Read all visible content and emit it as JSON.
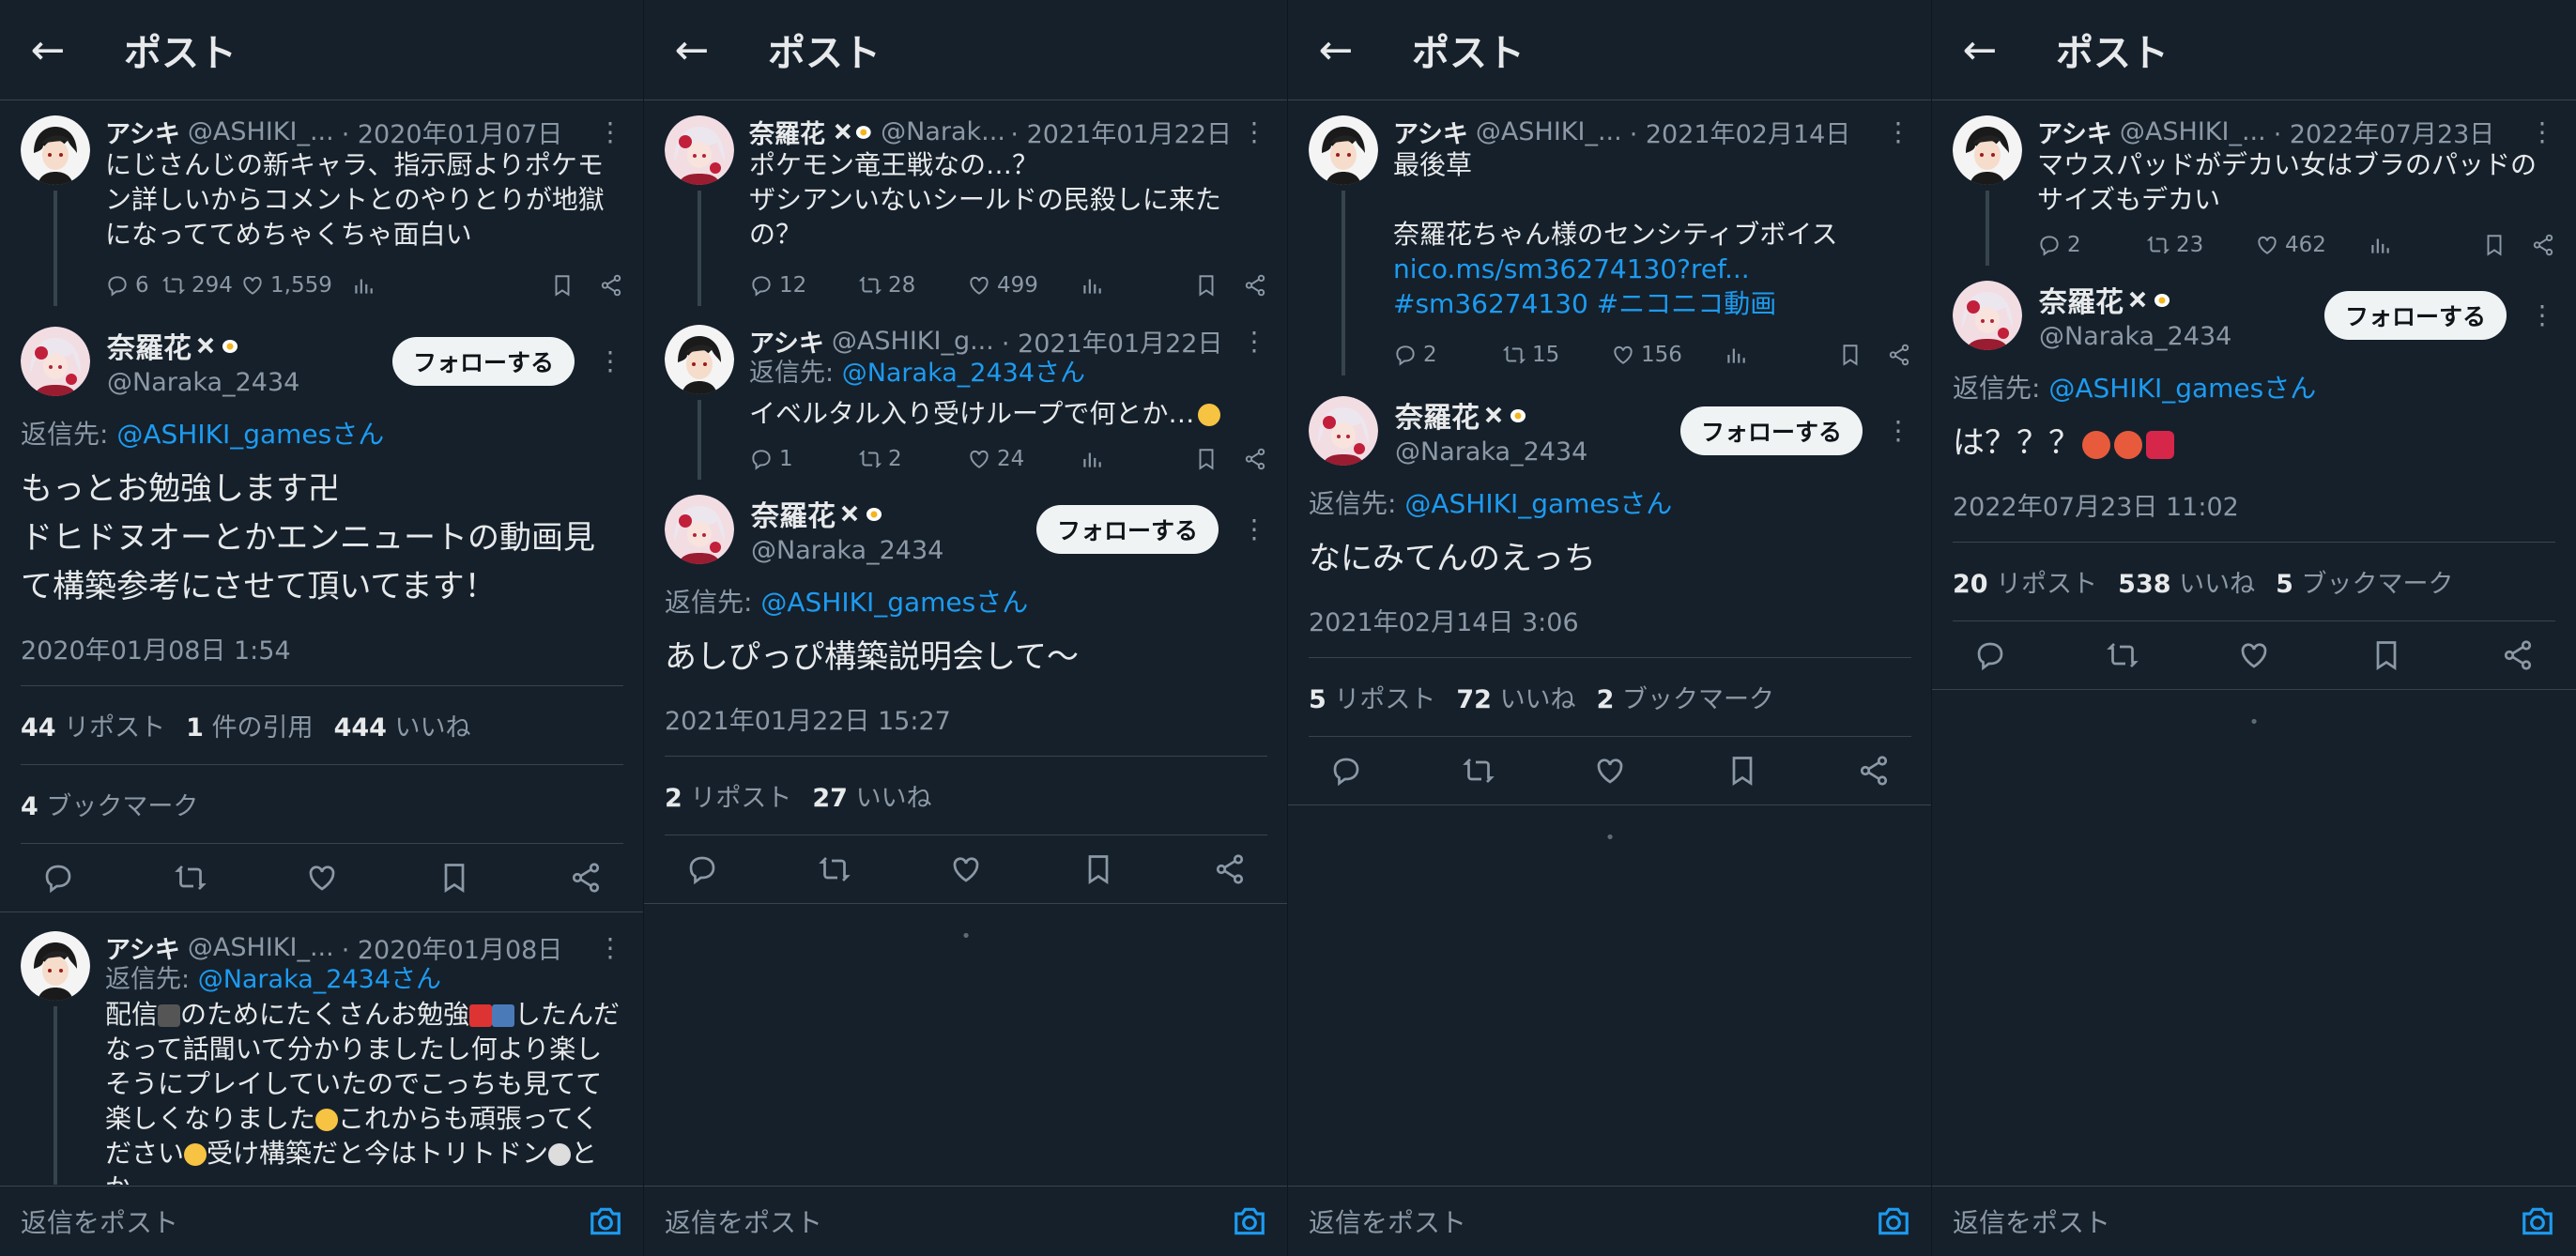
{
  "header_title": "ポスト",
  "reply_placeholder": "返信をポスト",
  "reply_prefix": "返信先: ",
  "follow_label": "フォローする",
  "colors": {
    "bg": "#15202b",
    "link": "#1d9bf0",
    "muted": "#8b98a5",
    "text": "#e7e9ea",
    "border": "#38444d"
  },
  "screens": [
    {
      "parent": {
        "name": "アシキ",
        "handle": "@ASHIKI_...",
        "date": "· 2020年01月07日",
        "text": "にじさんじの新キャラ、指示厨よりポケモン詳しいからコメントとのやりとりが地獄になっててめちゃくちゃ面白い",
        "replies": "6",
        "reposts": "294",
        "likes": "1,559"
      },
      "main": {
        "name": "奈羅花",
        "handle": "@Naraka_2434",
        "reply_to": "@ASHIKI_gamesさん",
        "text": "もっとお勉強します卍\nドヒドヌオーとかエンニュートの動画見て構築参考にさせて頂いてます！",
        "datetime": "2020年01月08日 1:54",
        "stat1_num": "44",
        "stat1_label": "リポスト",
        "stat2_num": "1",
        "stat2_label": "件の引用",
        "stat3_num": "444",
        "stat3_label": "いいね",
        "stat4_num": "4",
        "stat4_label": "ブックマーク"
      },
      "reply": {
        "name": "アシキ",
        "handle": "@ASHIKI_...",
        "date": "· 2020年01月08日",
        "reply_to": "@Naraka_2434さん",
        "text_a": "配信",
        "text_b": "のためにたくさんお勉強",
        "text_c": "したんだなって話聞いて分かりましたし何より楽しそうにプレイしていたのでこっちも見てて楽しくなりました",
        "text_d": "これからも頑張ってください",
        "text_e": "受け構築だと今はトリトドン",
        "text_f": "とか"
      }
    },
    {
      "parent": {
        "name": "奈羅花",
        "handle": "@Narak...",
        "date": "· 2021年01月22日",
        "text": "ポケモン竜王戦なの…？\nザシアンいないシールドの民殺しに来たの？",
        "replies": "12",
        "reposts": "28",
        "likes": "499"
      },
      "parent2": {
        "name": "アシキ",
        "handle": "@ASHIKI_g...",
        "date": "· 2021年01月22日",
        "reply_to": "@Naraka_2434さん",
        "text": "イベルタル入り受けループで何とか…",
        "replies": "1",
        "reposts": "2",
        "likes": "24"
      },
      "main": {
        "name": "奈羅花",
        "handle": "@Naraka_2434",
        "reply_to": "@ASHIKI_gamesさん",
        "text": "あしぴっぴ構築説明会して〜",
        "datetime": "2021年01月22日 15:27",
        "stat1_num": "2",
        "stat1_label": "リポスト",
        "stat2_num": "27",
        "stat2_label": "いいね"
      }
    },
    {
      "parent": {
        "name": "アシキ",
        "handle": "@ASHIKI_...",
        "date": "· 2021年02月14日",
        "text": "最後草\n\n奈羅花ちゃん様のセンシティブボイス",
        "link_text": "nico.ms/sm36274130?ref... #sm36274130 #ニコニコ動画",
        "replies": "2",
        "reposts": "15",
        "likes": "156"
      },
      "main": {
        "name": "奈羅花",
        "handle": "@Naraka_2434",
        "reply_to": "@ASHIKI_gamesさん",
        "text": "なにみてんのえっち",
        "datetime": "2021年02月14日 3:06",
        "stat1_num": "5",
        "stat1_label": "リポスト",
        "stat2_num": "72",
        "stat2_label": "いいね",
        "stat3_num": "2",
        "stat3_label": "ブックマーク"
      }
    },
    {
      "parent": {
        "name": "アシキ",
        "handle": "@ASHIKI_...",
        "date": "· 2022年07月23日",
        "text": "マウスパッドがデカい女はブラのパッドのサイズもデカい",
        "replies": "2",
        "reposts": "23",
        "likes": "462"
      },
      "main": {
        "name": "奈羅花",
        "handle": "@Naraka_2434",
        "reply_to": "@ASHIKI_gamesさん",
        "text": "は？？？",
        "datetime": "2022年07月23日 11:02",
        "stat1_num": "20",
        "stat1_label": "リポスト",
        "stat2_num": "538",
        "stat2_label": "いいね",
        "stat3_num": "5",
        "stat3_label": "ブックマーク"
      }
    }
  ]
}
